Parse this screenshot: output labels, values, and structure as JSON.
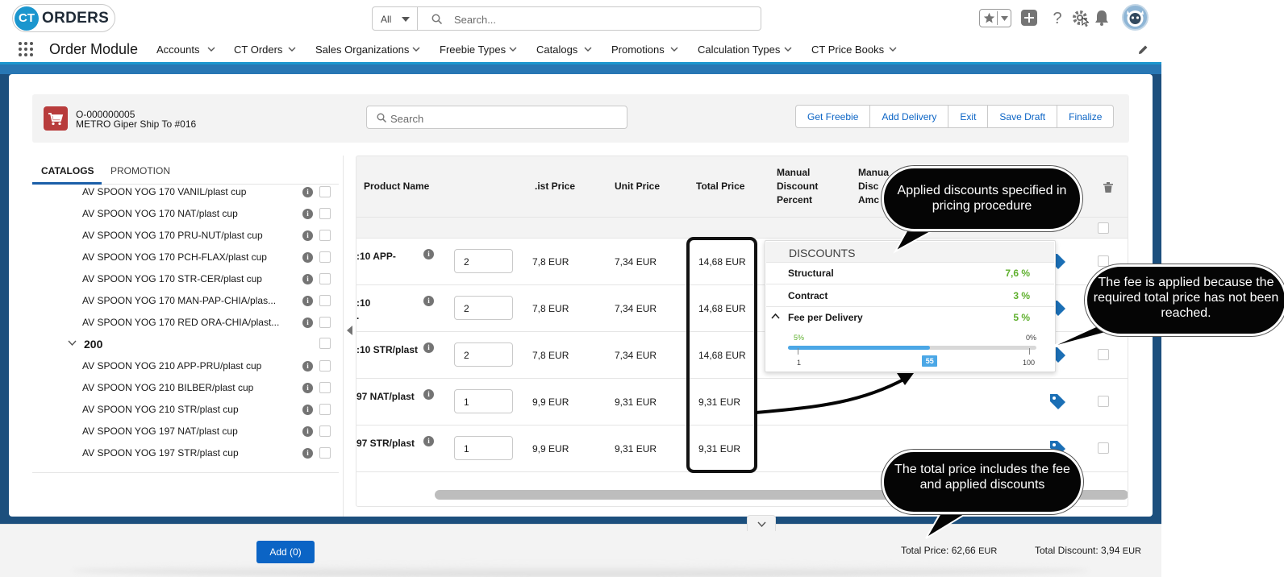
{
  "header": {
    "logo_ct": "CT",
    "logo_word": "ORDERS",
    "search_scope": "All",
    "search_placeholder": "Search..."
  },
  "nav": {
    "app_name": "Order Module",
    "items": [
      {
        "label": "Accounts"
      },
      {
        "label": "CT Orders"
      },
      {
        "label": "Sales Organizations"
      },
      {
        "label": "Freebie Types"
      },
      {
        "label": "Catalogs"
      },
      {
        "label": "Promotions"
      },
      {
        "label": "Calculation Types"
      },
      {
        "label": "CT Price Books"
      }
    ]
  },
  "order": {
    "number": "O-000000005",
    "ship_to": "METRO Giper Ship To #016",
    "search_placeholder": "Search",
    "buttons": [
      "Get Freebie",
      "Add Delivery",
      "Exit",
      "Save Draft",
      "Finalize"
    ]
  },
  "left_panel": {
    "tabs": [
      "CATALOGS",
      "PROMOTION"
    ],
    "items_before": [
      "AV SPOON YOG 170 VANIL/plast cup",
      "AV SPOON YOG 170 NAT/plast cup",
      "AV SPOON YOG 170 PRU-NUT/plast cup",
      "AV SPOON YOG 170 PCH-FLAX/plast cup",
      "AV SPOON YOG 170 STR-CER/plast cup",
      "AV SPOON YOG 170 MAN-PAP-CHIA/plas...",
      "AV SPOON YOG 170 RED ORA-CHIA/plast..."
    ],
    "group_label": "200",
    "items_after": [
      "AV SPOON YOG 210 APP-PRU/plast cup",
      "AV SPOON YOG 210 BILBER/plast cup",
      "AV SPOON YOG 210 STR/plast cup",
      "AV SPOON YOG 197 NAT/plast cup",
      "AV SPOON YOG 197 STR/plast cup"
    ]
  },
  "table": {
    "headers": {
      "product_name": "Product Name",
      "list_price": ".ist Price",
      "unit_price": "Unit Price",
      "total_price": "Total Price",
      "manual_discount_percent": [
        "Manual",
        "Discount",
        "Percent"
      ],
      "manual_discount_amount": [
        "Manua",
        "Disc",
        "Amc"
      ]
    },
    "rows": [
      {
        "name1": ":10 APP-",
        "name2": "",
        "qty": "2",
        "list_price": "7,8",
        "unit_price": "7,34",
        "total_price": "14,68",
        "currency": "EUR"
      },
      {
        "name1": ":10",
        "name2": ".",
        "qty": "2",
        "list_price": "7,8",
        "unit_price": "7,34",
        "total_price": "14,68",
        "currency": "EUR"
      },
      {
        "name1": ":10 STR/plast",
        "name2": "",
        "qty": "2",
        "list_price": "7,8",
        "unit_price": "7,34",
        "total_price": "14,68",
        "currency": "EUR"
      },
      {
        "name1": "97 NAT/plast",
        "name2": "",
        "qty": "1",
        "list_price": "9,9",
        "unit_price": "9,31",
        "total_price": "9,31",
        "currency": "EUR"
      },
      {
        "name1": "97 STR/plast",
        "name2": "",
        "qty": "1",
        "list_price": "9,9",
        "unit_price": "9,31",
        "total_price": "9,31",
        "currency": "EUR"
      }
    ]
  },
  "discounts": {
    "title": "DISCOUNTS",
    "items": [
      {
        "label": "Structural",
        "value": "7,6 %"
      },
      {
        "label": "Contract",
        "value": "3 %"
      },
      {
        "label": "Fee per Delivery",
        "value": "5 %"
      }
    ],
    "slider": {
      "label_left_top": "5%",
      "label_right_top": "0%",
      "min_label": "1",
      "max_label": "100",
      "value_label": "55",
      "fill_fraction": 0.57,
      "thumb_fraction": 0.54
    }
  },
  "callouts": {
    "discounts": "Applied discounts specified in pricing procedure",
    "fee": "The fee is applied because the required total price has not been reached.",
    "total": "The total price includes the fee and applied discounts"
  },
  "footer": {
    "add_button": "Add (0)",
    "total_price_label": "Total Price: 62,66",
    "total_discount_label": "Total Discount: 3,94",
    "currency": "EUR"
  },
  "colors": {
    "brand_blue": "#1b96ce",
    "link_blue": "#0b64c5",
    "discount_green": "#5fb02e",
    "cart_red": "#b83c3c"
  }
}
